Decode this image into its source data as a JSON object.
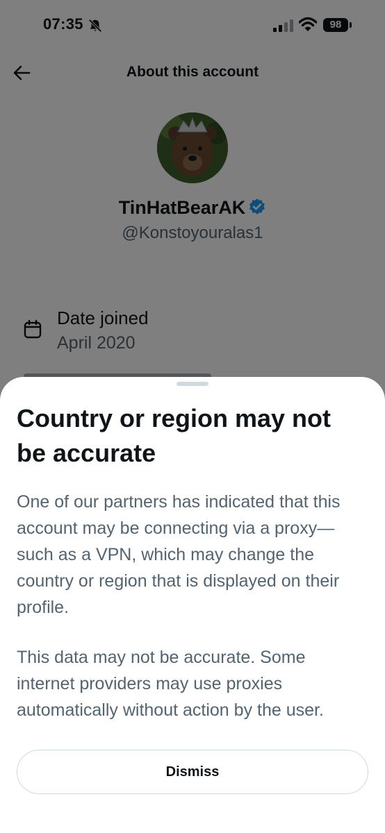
{
  "status_bar": {
    "time": "07:35",
    "battery": "98"
  },
  "header": {
    "title": "About this account"
  },
  "profile": {
    "display_name": "TinHatBearAK",
    "handle": "@Konstoyouralas1",
    "verified": true
  },
  "details": {
    "date_joined_label": "Date joined",
    "date_joined_value": "April 2020"
  },
  "sheet": {
    "title": "Country or region may not be accurate",
    "paragraph_1": "One of our partners has indicated that this account may be connecting via a proxy—such as a VPN, which may change the country or region that is displayed on their profile.",
    "paragraph_2": "This data may not be accurate. Some internet providers may use proxies automatically without action by the user.",
    "dismiss_label": "Dismiss"
  },
  "colors": {
    "text_primary": "#0f1419",
    "text_secondary": "#536471",
    "verified_blue": "#1d9bf0",
    "border": "#cfd9de"
  },
  "icons": [
    "bell-muted-icon",
    "signal-icon",
    "wifi-icon",
    "back-arrow-icon",
    "verified-badge-icon",
    "calendar-icon"
  ]
}
